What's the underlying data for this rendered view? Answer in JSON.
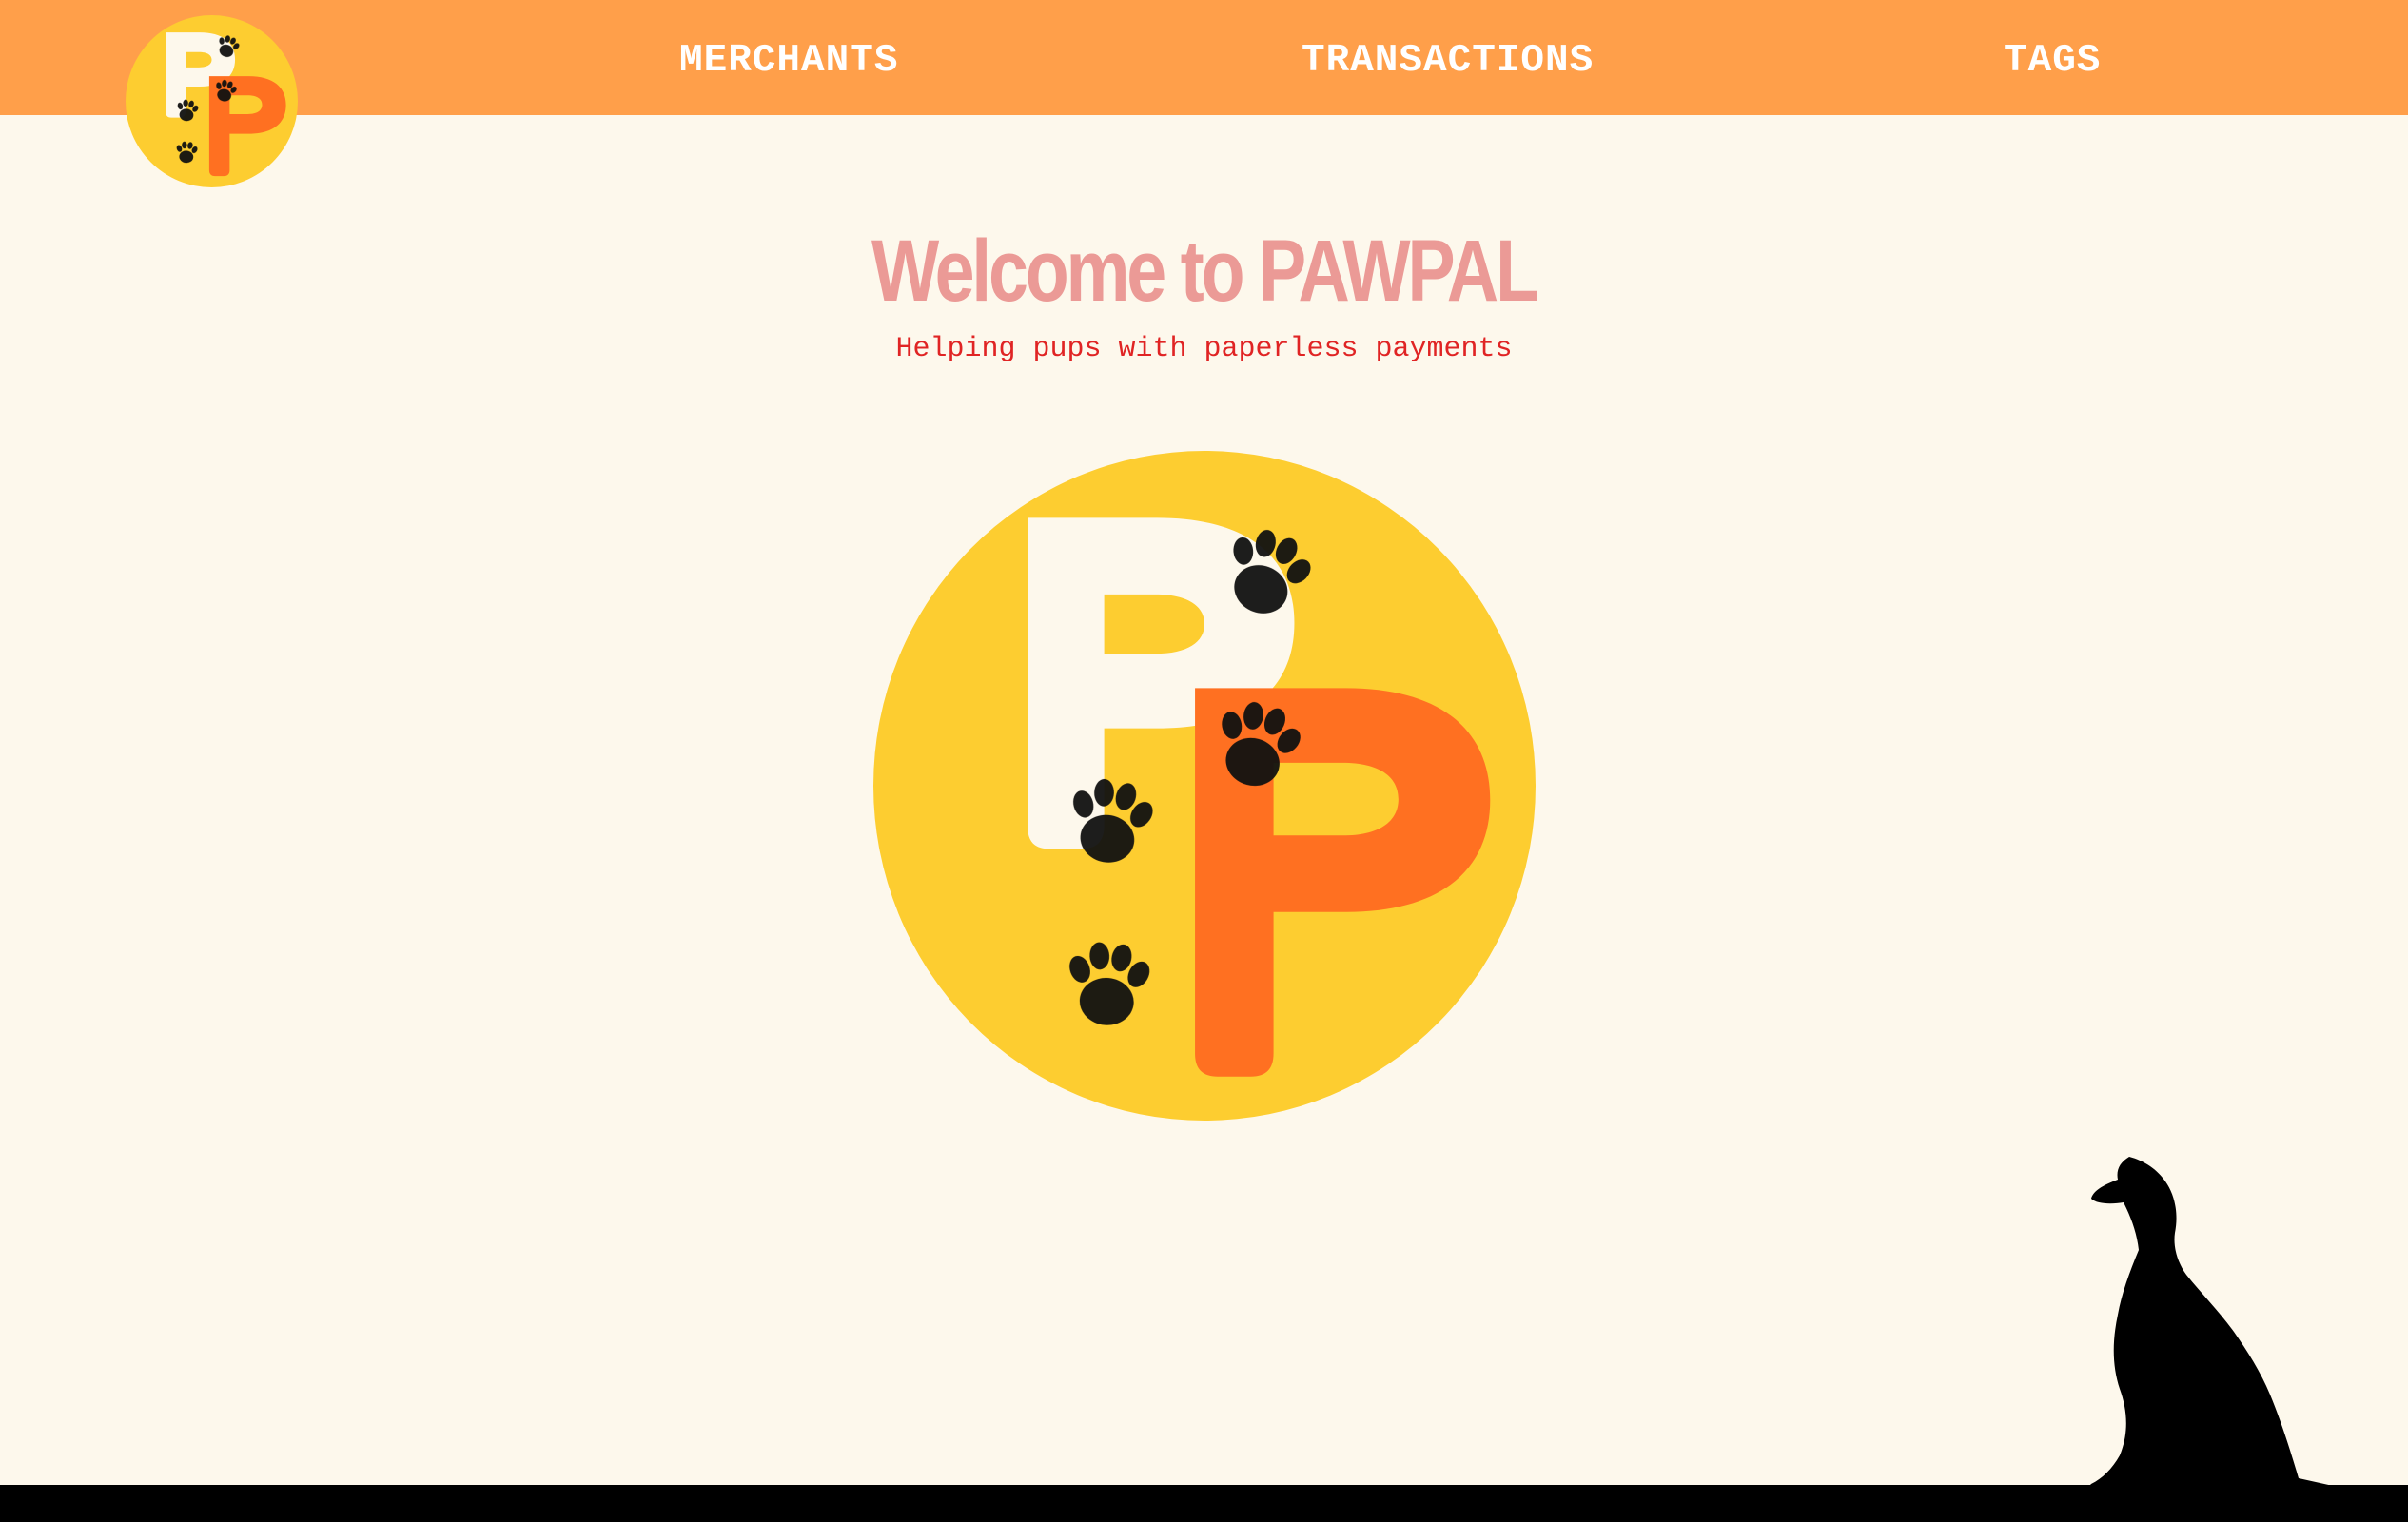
{
  "nav": {
    "logo_icon": "pawpal-logo-icon",
    "links": [
      {
        "label": "MERCHANTS"
      },
      {
        "label": "TRANSACTIONS"
      },
      {
        "label": "TAGS"
      }
    ]
  },
  "hero": {
    "title": "Welcome to PAWPAL",
    "subtitle": "Helping pups with paperless payments",
    "logo_icon": "pawpal-logo-icon"
  },
  "decor": {
    "dog_icon": "dog-silhouette-icon"
  },
  "colors": {
    "navbar": "#ff9f4a",
    "background": "#fdf8ec",
    "title": "#eb9a96",
    "subtitle": "#e02424",
    "logo_circle": "#fdcd30",
    "logo_orange_p": "#ff7021",
    "logo_white_p": "#fdf8ec",
    "footer": "#000000"
  }
}
